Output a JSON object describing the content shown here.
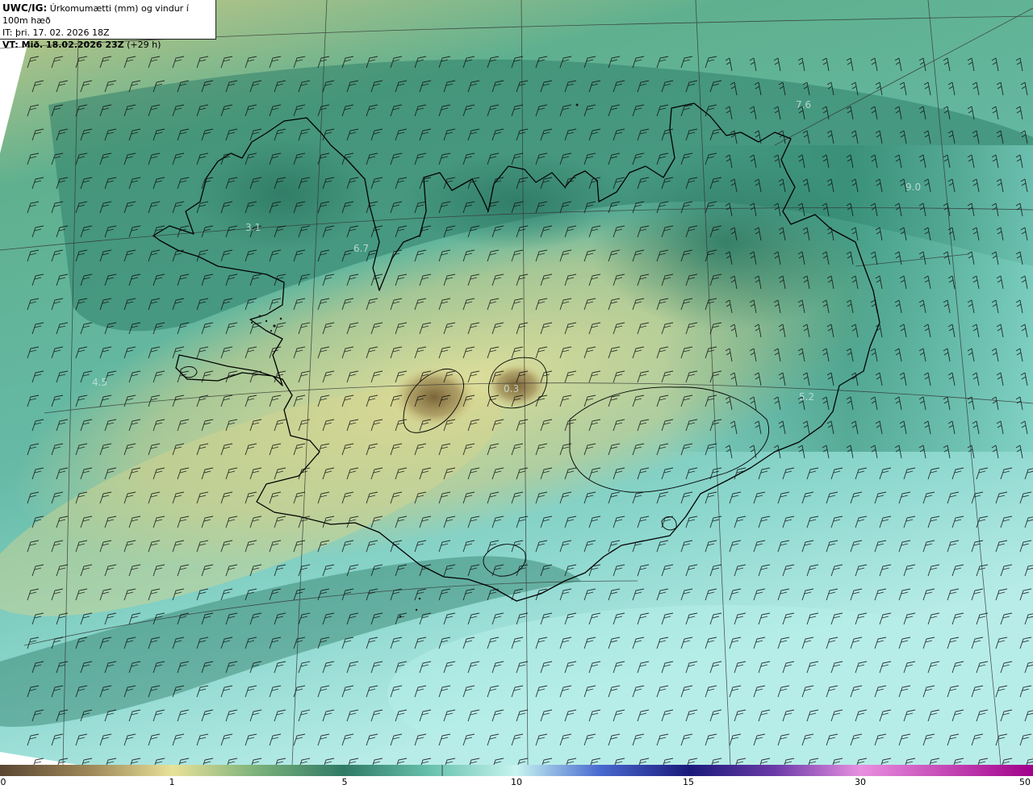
{
  "info": {
    "title_strong": "UWC/IG:",
    "title_rest": "Úrkomumætti (mm) og vindur í 100m hæð",
    "it_line": "IT: þri. 17. 02. 2026 18Z",
    "vt_strong": "VT: Mið. 18.02.2026 23Z",
    "vt_rest": "(+29 h)"
  },
  "map_labels": [
    {
      "id": "label-west",
      "text": "3.1"
    },
    {
      "id": "label-westfjords",
      "text": "6.7"
    },
    {
      "id": "label-northeast-sea",
      "text": "7.6"
    },
    {
      "id": "label-east-sea",
      "text": "9.0"
    },
    {
      "id": "label-vatnajokull",
      "text": "0.3"
    },
    {
      "id": "label-east-coast",
      "text": "5.2"
    },
    {
      "id": "label-west-sea",
      "text": "4.5"
    }
  ],
  "colorbar": {
    "ticks": [
      "0",
      "1",
      "5",
      "10",
      "15",
      "30",
      "50"
    ],
    "colors": [
      "#5a4632",
      "#e8e29a",
      "#2f7a66",
      "#c8f4f0",
      "#1a1a7a",
      "#e890e0",
      "#a0008a"
    ]
  },
  "colors": {
    "land_low": "#d9d68c",
    "land_high": "#7c6a3e",
    "sea_far": "#9fe2dc",
    "sea_mid": "#4aa48c",
    "coastline": "#000000",
    "grid": "#333333",
    "barb": "#111111"
  }
}
